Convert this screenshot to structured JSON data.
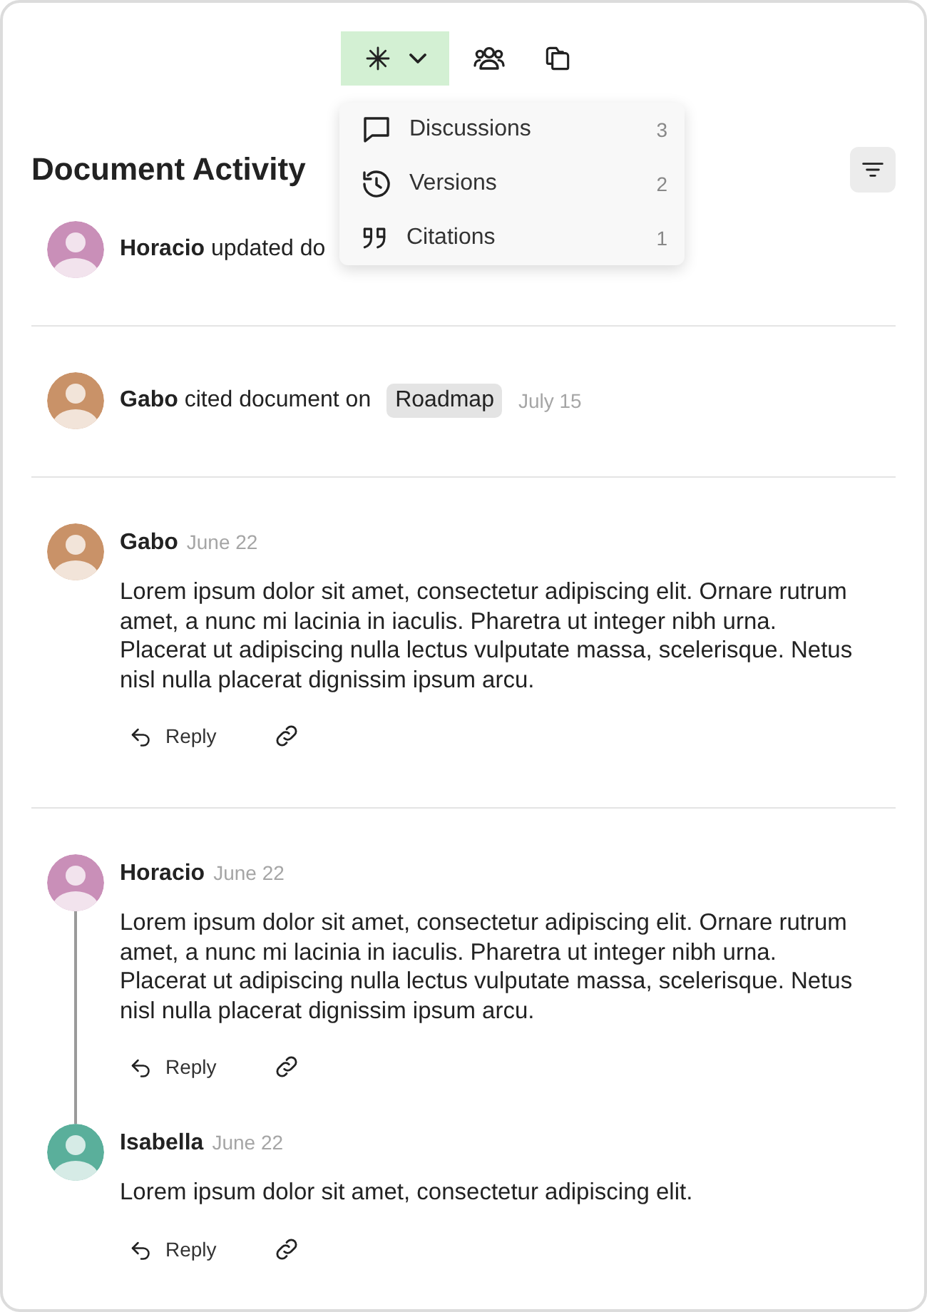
{
  "toolbar": {
    "tabs": [
      {
        "kind": "sparkle",
        "selected": true,
        "caret": true
      },
      {
        "kind": "people",
        "selected": false,
        "caret": false
      },
      {
        "kind": "copy",
        "selected": false,
        "caret": false
      }
    ]
  },
  "menu": {
    "items": [
      {
        "kind": "discussions",
        "label": "Discussions",
        "count": "3"
      },
      {
        "kind": "versions",
        "label": "Versions",
        "count": "2"
      },
      {
        "kind": "citations",
        "label": "Citations",
        "count": "1"
      }
    ]
  },
  "header": {
    "title": "Document Activity"
  },
  "activities": [
    {
      "kind": "event",
      "author": "Horacio",
      "color": "#c98fb8",
      "action": "updated do"
    },
    {
      "kind": "event",
      "author": "Gabo",
      "color": "#c99268",
      "action": "cited document on",
      "tag": "Roadmap",
      "date": "July 15"
    },
    {
      "kind": "comment",
      "author": "Gabo",
      "color": "#c99268",
      "date": "June 22",
      "body": "Lorem ipsum dolor sit amet, consectetur adipiscing elit. Ornare rutrum amet, a nunc mi lacinia in iaculis. Pharetra ut integer nibh urna. Placerat ut adipiscing nulla lectus vulputate massa, scelerisque. Netus nisl nulla placerat dignissim ipsum arcu.",
      "reply": "Reply"
    },
    {
      "kind": "thread",
      "comments": [
        {
          "author": "Horacio",
          "color": "#c98fb8",
          "date": "June 22",
          "body": "Lorem ipsum dolor sit amet, consectetur adipiscing elit. Ornare rutrum amet, a nunc mi lacinia in iaculis. Pharetra ut integer nibh urna. Placerat ut adipiscing nulla lectus vulputate massa, scelerisque. Netus nisl nulla placerat dignissim ipsum arcu.",
          "reply": "Reply"
        },
        {
          "author": "Isabella",
          "color": "#5aaf9b",
          "date": "June 22",
          "body": "Lorem ipsum dolor sit amet, consectetur adipiscing elit.",
          "reply": "Reply"
        }
      ]
    }
  ]
}
